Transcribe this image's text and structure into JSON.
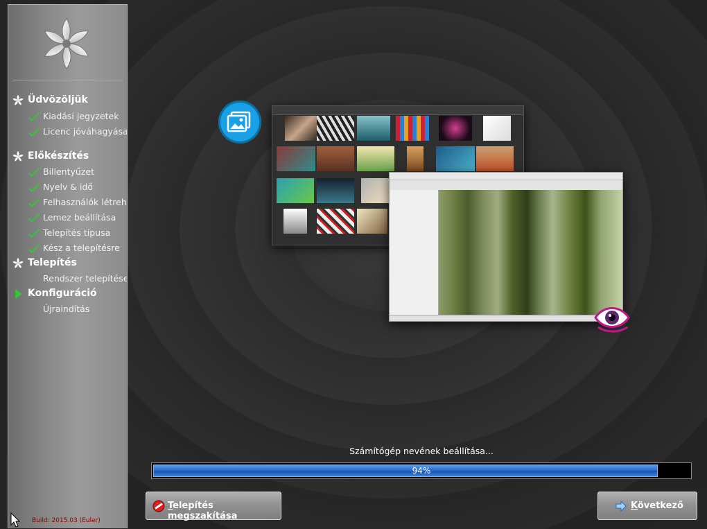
{
  "sidebar": {
    "steps": [
      {
        "label": "Üdvözöljük",
        "kind": "category",
        "icon": "pinwheel-icon"
      },
      {
        "label": "Kiadási jegyzetek",
        "kind": "done",
        "icon": "checkmark-icon"
      },
      {
        "label": "Licenc jóváhagyása",
        "kind": "done",
        "icon": "checkmark-icon"
      },
      {
        "label": "Előkészítés",
        "kind": "category",
        "icon": "pinwheel-icon"
      },
      {
        "label": "Billentyűzet",
        "kind": "done",
        "icon": "checkmark-icon"
      },
      {
        "label": "Nyelv & idő",
        "kind": "done",
        "icon": "checkmark-icon"
      },
      {
        "label": "Felhasználók létrehozása",
        "kind": "done",
        "icon": "checkmark-icon"
      },
      {
        "label": "Lemez beállítása",
        "kind": "done",
        "icon": "checkmark-icon"
      },
      {
        "label": "Telepítés típusa",
        "kind": "done",
        "icon": "checkmark-icon"
      },
      {
        "label": "Kész a telepítésre",
        "kind": "done",
        "icon": "checkmark-icon"
      },
      {
        "label": "Telepítés",
        "kind": "category",
        "icon": "pinwheel-icon"
      },
      {
        "label": "Rendszer telepítése",
        "kind": "pending",
        "icon": ""
      },
      {
        "label": "Konfiguráció",
        "kind": "current-category",
        "icon": "play-arrow-icon"
      },
      {
        "label": "Újraindítás",
        "kind": "pending",
        "icon": ""
      }
    ],
    "build": "Build: 2015.03 (Euler)"
  },
  "progress": {
    "status": "Számítógép nevének beállítása...",
    "percent": 94,
    "percent_label": "94%"
  },
  "buttons": {
    "cancel": {
      "mnemonic": "T",
      "rest": "elepítés megszakítása",
      "icon": "stop-icon"
    },
    "next": {
      "mnemonic": "K",
      "rest": "övetkező",
      "icon": "arrow-right-icon"
    }
  },
  "colors": {
    "accent": "#2a6fd0",
    "check": "#36c23a",
    "build_text": "#8b0000"
  }
}
